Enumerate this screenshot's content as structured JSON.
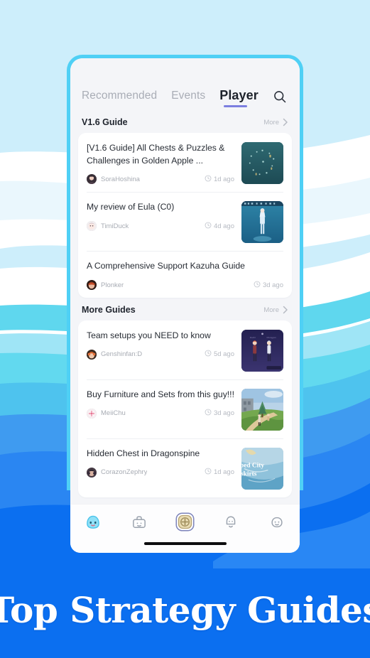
{
  "background": {
    "sky": "#cdeefb",
    "wave_white": "#ffffff",
    "wave_cyan": "#5fd7ee",
    "wave_light_cyan": "#9fe5f6",
    "wave_blue": "#3f9bf0",
    "wave_deep_blue": "#0b6ff0"
  },
  "phone": {
    "frame_color": "#4fd0f5",
    "screen_bg": "#f4f5f8"
  },
  "tabs": [
    {
      "label": "Recommended",
      "active": false
    },
    {
      "label": "Events",
      "active": false
    },
    {
      "label": "Player",
      "active": true
    }
  ],
  "tab_accent": "#7c7fe0",
  "search": {
    "icon": "search-icon",
    "label": "Search"
  },
  "sections": [
    {
      "title": "V1.6 Guide",
      "more_label": "More",
      "items": [
        {
          "title": "[V1.6 Guide] All Chests & Puzzles & Challenges in Golden Apple ...",
          "author": "SoraHoshina",
          "time": "1d ago",
          "thumb": "golden-apple-map"
        },
        {
          "title": "My review of Eula (C0)",
          "author": "TimiDuck",
          "time": "4d ago",
          "thumb": "eula-character"
        },
        {
          "title": "A Comprehensive Support Kazuha Guide",
          "author": "Plonker",
          "time": "3d ago",
          "thumb": null
        }
      ]
    },
    {
      "title": "More Guides",
      "more_label": "More",
      "items": [
        {
          "title": "Team setups you NEED to know",
          "author": "Genshinfan:D",
          "time": "5d ago",
          "thumb": "two-characters-night"
        },
        {
          "title": "Buy Furniture and Sets from this guy!!!",
          "author": "MeiiChu",
          "time": "3d ago",
          "thumb": "village-scene"
        },
        {
          "title": "Hidden Chest in Dragonspine",
          "author": "CorazonZephry",
          "time": "1d ago",
          "thumb": "city-outskirts-map"
        }
      ]
    }
  ],
  "bottom_nav": [
    {
      "icon": "slime-home-icon",
      "active": true
    },
    {
      "icon": "toolbox-icon",
      "active": false
    },
    {
      "icon": "add-compass-icon",
      "active": false
    },
    {
      "icon": "bell-icon",
      "active": false
    },
    {
      "icon": "profile-ghost-icon",
      "active": false
    }
  ],
  "banner": {
    "text": "Top Strategy Guides",
    "bg": "#0b6ff0",
    "text_color": "#ffffff"
  }
}
